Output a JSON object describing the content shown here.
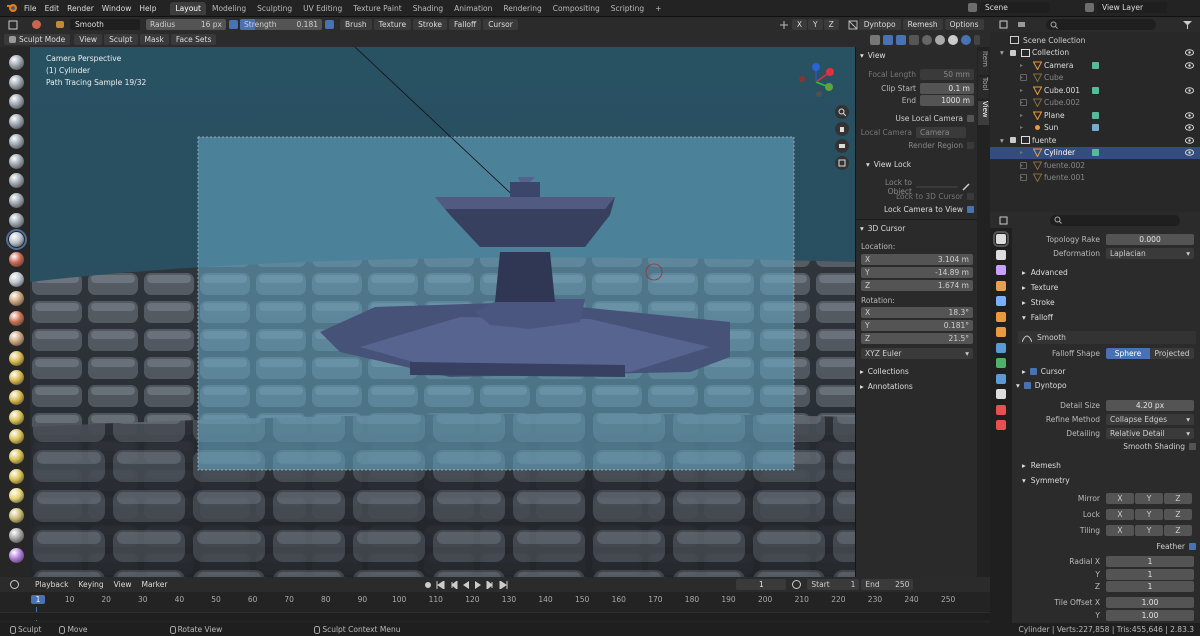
{
  "topbar": {
    "menus": [
      "File",
      "Edit",
      "Render",
      "Window",
      "Help"
    ],
    "workspaces": [
      "Layout",
      "Modeling",
      "Sculpting",
      "UV Editing",
      "Texture Paint",
      "Shading",
      "Animation",
      "Rendering",
      "Compositing",
      "Scripting"
    ],
    "active_workspace": "Layout",
    "add_tab": "+",
    "scene_label": "Scene",
    "view_layer_label": "View Layer"
  },
  "toolheader": {
    "brush_name": "Smooth",
    "radius_label": "Radius",
    "radius_value": "16 px",
    "strength_label": "Strength",
    "strength_value": "0.181",
    "brush_menu": "Brush",
    "texture_menu": "Texture",
    "stroke_menu": "Stroke",
    "falloff_menu": "Falloff",
    "cursor_menu": "Cursor",
    "axes": [
      "X",
      "Y",
      "Z"
    ],
    "dyntopo": "Dyntopo",
    "remesh": "Remesh",
    "options": "Options"
  },
  "modeheader": {
    "mode": "Sculpt Mode",
    "menus": [
      "View",
      "Sculpt",
      "Mask",
      "Face Sets"
    ]
  },
  "viewport": {
    "overlay_lines": [
      "Camera Perspective",
      "(1) Cylinder",
      "Path Tracing Sample 19/32"
    ]
  },
  "npanel": {
    "tabs": [
      "Item",
      "Tool",
      "View"
    ],
    "view_header": "View",
    "focal_length_label": "Focal Length",
    "focal_length": "50 mm",
    "clip_start_label": "Clip Start",
    "clip_start": "0.1 m",
    "end_label": "End",
    "clip_end": "1000 m",
    "use_local_camera": "Use Local Camera",
    "local_camera_label": "Local Camera",
    "local_camera_value": "Camera",
    "render_region": "Render Region",
    "view_lock_header": "View Lock",
    "lock_to_object": "Lock to Object",
    "lock_to_3d_cursor": "Lock to 3D Cursor",
    "lock_camera_to_view": "Lock Camera to View",
    "cursor_header": "3D Cursor",
    "location_label": "Location:",
    "location": [
      {
        "axis": "X",
        "value": "3.104 m"
      },
      {
        "axis": "Y",
        "value": "-14.89 m"
      },
      {
        "axis": "Z",
        "value": "1.674 m"
      }
    ],
    "rotation_label": "Rotation:",
    "rotation": [
      {
        "axis": "X",
        "value": "18.3°"
      },
      {
        "axis": "Y",
        "value": "0.181°"
      },
      {
        "axis": "Z",
        "value": "21.5°"
      }
    ],
    "rotation_mode": "XYZ Euler",
    "collections": "Collections",
    "annotations": "Annotations"
  },
  "timeline": {
    "menus": [
      "Playback",
      "Keying",
      "View",
      "Marker"
    ],
    "current_frame": "1",
    "start_label": "Start",
    "start": "1",
    "end_label": "End",
    "end": "250",
    "ticks": [
      "1",
      "10",
      "20",
      "30",
      "40",
      "50",
      "60",
      "70",
      "80",
      "90",
      "100",
      "110",
      "120",
      "130",
      "140",
      "150",
      "160",
      "170",
      "180",
      "190",
      "200",
      "210",
      "220",
      "230",
      "240",
      "250"
    ]
  },
  "statusbar": {
    "left": [
      "Sculpt",
      "Move",
      "Rotate View",
      "Sculpt Context Menu"
    ],
    "right": "Cylinder | Verts:227,858 | Tris:455,646 | 2.83.3"
  },
  "outliner": {
    "root": "Scene Collection",
    "items": [
      {
        "name": "Collection",
        "indent": 1,
        "type": "collection",
        "selected": false,
        "dim": false
      },
      {
        "name": "Camera",
        "indent": 2,
        "type": "camera",
        "selected": false,
        "dim": false
      },
      {
        "name": "Cube",
        "indent": 2,
        "type": "mesh",
        "selected": false,
        "dim": true
      },
      {
        "name": "Cube.001",
        "indent": 2,
        "type": "mesh",
        "selected": false,
        "dim": false
      },
      {
        "name": "Cube.002",
        "indent": 2,
        "type": "mesh",
        "selected": false,
        "dim": true
      },
      {
        "name": "Plane",
        "indent": 2,
        "type": "mesh",
        "selected": false,
        "dim": false
      },
      {
        "name": "Sun",
        "indent": 2,
        "type": "light",
        "selected": false,
        "dim": false
      },
      {
        "name": "fuente",
        "indent": 1,
        "type": "collection",
        "selected": false,
        "dim": false
      },
      {
        "name": "Cylinder",
        "indent": 2,
        "type": "mesh",
        "selected": true,
        "dim": false
      },
      {
        "name": "fuente.002",
        "indent": 2,
        "type": "mesh",
        "selected": false,
        "dim": true
      },
      {
        "name": "fuente.001",
        "indent": 2,
        "type": "mesh",
        "selected": false,
        "dim": true
      }
    ]
  },
  "properties": {
    "topology_rake_label": "Topology Rake",
    "topology_rake": "0.000",
    "deformation_label": "Deformation",
    "deformation": "Laplacian",
    "advanced": "Advanced",
    "texture": "Texture",
    "stroke": "Stroke",
    "falloff": "Falloff",
    "falloff_preset": "Smooth",
    "falloff_shape_label": "Falloff Shape",
    "falloff_shape_options": [
      "Sphere",
      "Projected"
    ],
    "cursor": "Cursor",
    "dyntopo": "Dyntopo",
    "detail_size_label": "Detail Size",
    "detail_size": "4.20 px",
    "refine_method_label": "Refine Method",
    "refine_method": "Collapse Edges",
    "detailing_label": "Detailing",
    "detailing": "Relative Detail",
    "smooth_shading": "Smooth Shading",
    "remesh": "Remesh",
    "symmetry": "Symmetry",
    "mirror_label": "Mirror",
    "lock_label": "Lock",
    "tiling_label": "Tiling",
    "axes": [
      "X",
      "Y",
      "Z"
    ],
    "feather": "Feather",
    "radial_x_label": "Radial X",
    "radial": [
      {
        "axis": "Radial X",
        "value": "1"
      },
      {
        "axis": "Y",
        "value": "1"
      },
      {
        "axis": "Z",
        "value": "1"
      }
    ],
    "tile_offset_label": "Tile Offset X",
    "tile_offset": [
      {
        "axis": "Tile Offset X",
        "value": "1.00"
      },
      {
        "axis": "Y",
        "value": "1.00"
      }
    ]
  },
  "colors": {
    "accent": "#4772b3",
    "active_tool": "#4d6e9e",
    "panel": "#2b2b2b"
  }
}
